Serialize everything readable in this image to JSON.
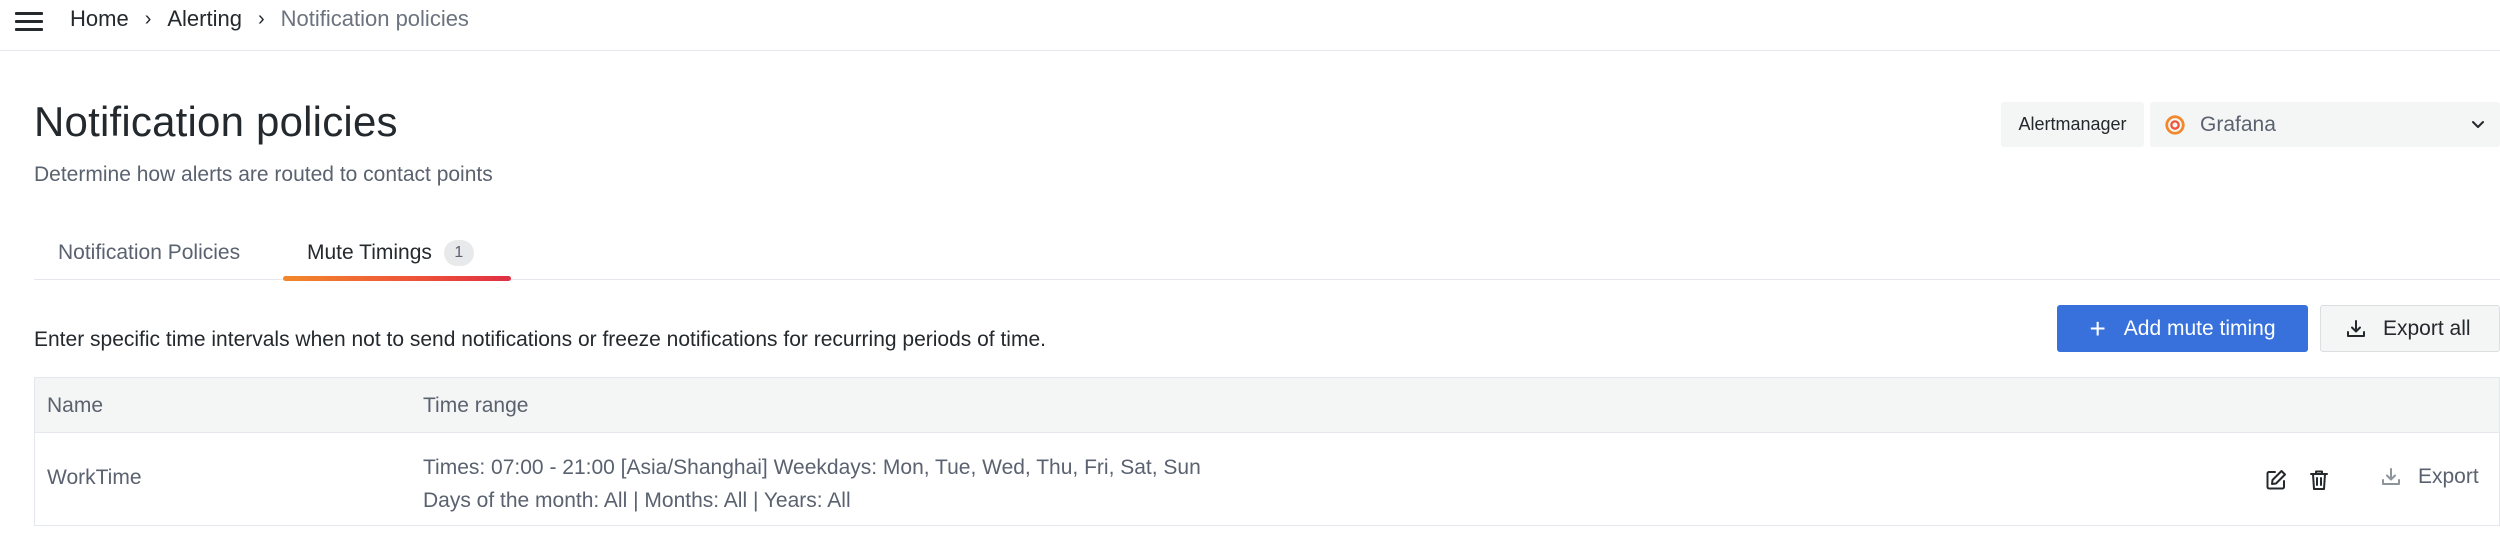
{
  "breadcrumb": {
    "items": [
      "Home",
      "Alerting"
    ],
    "current": "Notification policies"
  },
  "header": {
    "title": "Notification policies",
    "subtitle": "Determine how alerts are routed to contact points"
  },
  "alertmanager": {
    "label": "Alertmanager",
    "selected": "Grafana"
  },
  "tabs": [
    {
      "label": "Notification Policies",
      "active": false
    },
    {
      "label": "Mute Timings",
      "count": "1",
      "active": true
    }
  ],
  "mute_timings": {
    "description": "Enter specific time intervals when not to send notifications or freeze notifications for recurring periods of time.",
    "add_button": "Add mute timing",
    "export_all_button": "Export all",
    "columns": [
      "Name",
      "Time range"
    ],
    "rows": [
      {
        "name": "WorkTime",
        "time_line1": "Times: 07:00 - 21:00 [Asia/Shanghai] Weekdays: Mon, Tue, Wed, Thu, Fri, Sat, Sun",
        "time_line2": "Days of the month: All | Months: All | Years: All",
        "export_label": "Export"
      }
    ]
  },
  "colors": {
    "primary": "#3871dc",
    "tab_gradient_start": "#f2882b",
    "tab_gradient_end": "#e02f44",
    "text": "#24292e",
    "text_secondary": "#5a6270"
  },
  "icons": {
    "menu": "hamburger-icon",
    "breadcrumb_separator": "chevron-right-icon",
    "alertmanager_logo": "grafana-logo-icon",
    "dropdown": "chevron-down-icon",
    "add": "plus-icon",
    "export": "download-icon",
    "edit": "edit-icon",
    "delete": "trash-icon"
  }
}
